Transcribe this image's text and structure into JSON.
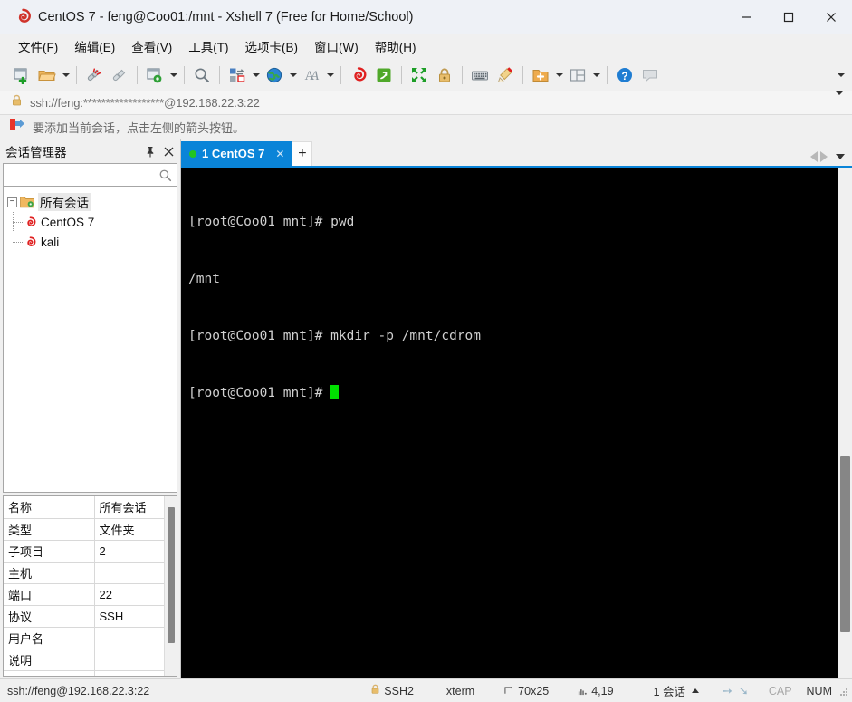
{
  "window": {
    "title": "CentOS 7 - feng@Coo01:/mnt - Xshell 7 (Free for Home/School)",
    "app_icon": "xshell-logo-icon",
    "minimize": "—",
    "maximize": "□",
    "close": "✕"
  },
  "menubar": {
    "items": [
      {
        "label": "文件(F)",
        "name": "menu-file"
      },
      {
        "label": "编辑(E)",
        "name": "menu-edit"
      },
      {
        "label": "查看(V)",
        "name": "menu-view"
      },
      {
        "label": "工具(T)",
        "name": "menu-tools"
      },
      {
        "label": "选项卡(B)",
        "name": "menu-tabs"
      },
      {
        "label": "窗口(W)",
        "name": "menu-window"
      },
      {
        "label": "帮助(H)",
        "name": "menu-help"
      }
    ]
  },
  "toolbar": {
    "buttons": [
      "new-session-icon",
      "open-folder-icon",
      "disconnect-icon",
      "reconnect-icon",
      "session-properties-icon",
      "find-icon",
      "transfer-file-icon",
      "globe-icon",
      "font-icon",
      "xshell-icon",
      "xftp-icon",
      "fullscreen-icon",
      "lock-icon",
      "keyboard-icon",
      "highlight-icon",
      "add-folder-icon",
      "layout-icon",
      "help-icon",
      "comment-icon"
    ]
  },
  "address_bar": {
    "lock_icon": "lock-icon",
    "url": "ssh://feng:******************@192.168.22.3:22",
    "dropdown_icon": "chevron-down-icon"
  },
  "notification": {
    "icon": "arrow-left-hint-icon",
    "text": "要添加当前会话，点击左侧的箭头按钮。"
  },
  "session_manager": {
    "title": "会话管理器",
    "pin_icon": "pin-icon",
    "close_icon": "close-icon",
    "search": {
      "value": "",
      "placeholder": "",
      "icon": "search-icon"
    },
    "tree": {
      "root": {
        "label": "所有会话",
        "icon": "folder-sessions-icon",
        "expanded": true,
        "toggle": "−"
      },
      "children": [
        {
          "label": "CentOS 7",
          "icon": "xshell-session-icon"
        },
        {
          "label": "kali",
          "icon": "xshell-session-icon"
        }
      ]
    },
    "properties": {
      "rows": [
        {
          "key": "名称",
          "value": "所有会话"
        },
        {
          "key": "类型",
          "value": "文件夹"
        },
        {
          "key": "子项目",
          "value": "2"
        },
        {
          "key": "主机",
          "value": ""
        },
        {
          "key": "端口",
          "value": "22"
        },
        {
          "key": "协议",
          "value": "SSH"
        },
        {
          "key": "用户名",
          "value": ""
        },
        {
          "key": "说明",
          "value": ""
        },
        {
          "key": "",
          "value": ""
        }
      ]
    }
  },
  "tabs": {
    "items": [
      {
        "index": "1",
        "label": "CentOS 7",
        "active": true,
        "status_dot": "connected-dot-icon",
        "close_icon": "close-icon"
      }
    ],
    "new_tab_label": "+",
    "nav_prev_icon": "chevron-left-icon",
    "nav_next_icon": "chevron-right-icon",
    "nav_list_icon": "chevron-down-icon"
  },
  "terminal": {
    "lines": [
      "[root@Coo01 mnt]# pwd",
      "/mnt",
      "[root@Coo01 mnt]# mkdir -p /mnt/cdrom",
      "[root@Coo01 mnt]# "
    ],
    "background": "#000000",
    "foreground": "#d0d0d0",
    "cursor_color": "#00e000"
  },
  "statusbar": {
    "url": "ssh://feng@192.168.22.3:22",
    "lock_icon": "lock-icon",
    "protocol": "SSH2",
    "term_type": "xterm",
    "size_icon": "resize-icon",
    "size": "70x25",
    "cursor_icon": "cursor-pos-icon",
    "cursor_pos": "4,19",
    "sessions": "1 会话",
    "sessions_caret_icon": "chevron-up-icon",
    "upload_icon": "arrow-up-icon",
    "download_icon": "arrow-down-icon",
    "cap": "CAP",
    "num": "NUM",
    "grip_icon": "resize-grip-icon"
  },
  "colors": {
    "accent": "#0a84d8",
    "titlebar": "#eef1f6",
    "chrome": "#f0f0f0",
    "terminal_bg": "#000000",
    "connected": "#22c522"
  }
}
